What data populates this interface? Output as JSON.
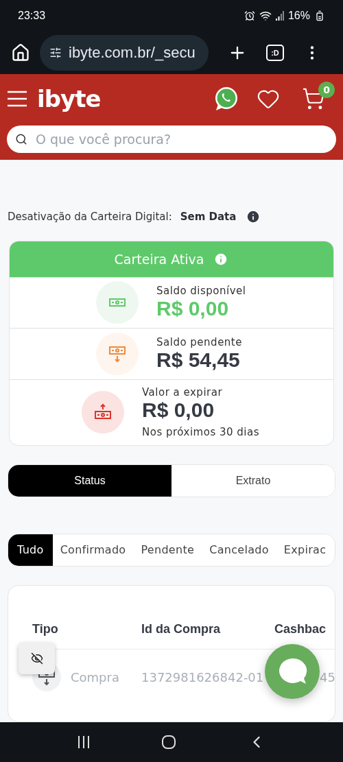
{
  "status_bar": {
    "time": "23:33",
    "battery": "16%"
  },
  "browser": {
    "url": "ibyte.com.br/_secu",
    "tab_label": ":D"
  },
  "header": {
    "logo": "ibyte",
    "cart_count": "0",
    "search": {
      "placeholder": "O que você procura?"
    }
  },
  "deactivation": {
    "label": "Desativação da Carteira Digital:",
    "value": "Sem Data"
  },
  "wallet": {
    "title": "Carteira Ativa",
    "rows": [
      {
        "kind": "available",
        "label": "Saldo disponível",
        "amount": "R$ 0,00"
      },
      {
        "kind": "pending",
        "label": "Saldo pendente",
        "amount": "R$ 54,45"
      },
      {
        "kind": "expiring",
        "label": "Valor a expirar",
        "amount": "R$ 0,00",
        "note": "Nos próximos 30 dias"
      }
    ]
  },
  "view_tabs": [
    {
      "label": "Status",
      "selected": true
    },
    {
      "label": "Extrato",
      "selected": false
    }
  ],
  "filters": [
    {
      "label": "Tudo",
      "selected": true
    },
    {
      "label": "Confirmado",
      "selected": false
    },
    {
      "label": "Pendente",
      "selected": false
    },
    {
      "label": "Cancelado",
      "selected": false
    },
    {
      "label": "Expirac",
      "selected": false
    }
  ],
  "table": {
    "columns": [
      "Tipo",
      "Id da Compra",
      "Cashbac"
    ],
    "rows": [
      {
        "type": "Compra",
        "id": "1372981626842-01",
        "cashback": "45"
      }
    ]
  }
}
